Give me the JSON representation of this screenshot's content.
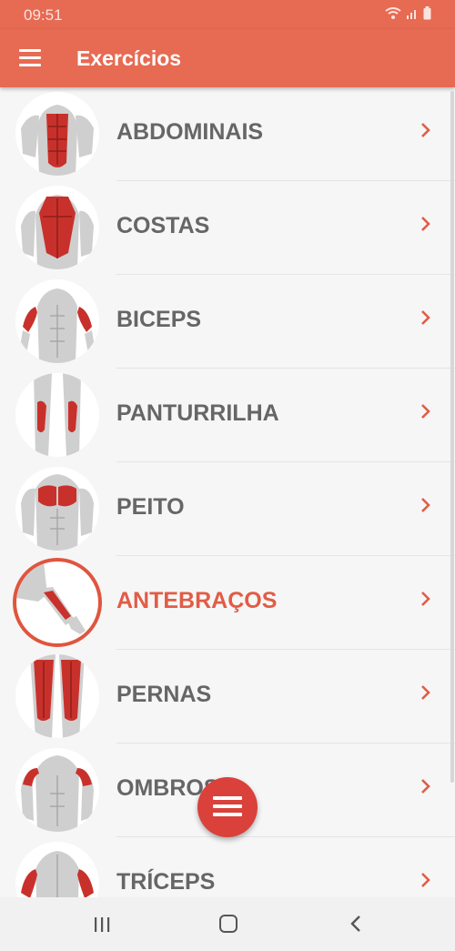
{
  "status_bar": {
    "time": "09:51"
  },
  "app_bar": {
    "title": "Exercícios"
  },
  "exercises": [
    {
      "label": "ABDOMINAIS",
      "selected": false
    },
    {
      "label": "COSTAS",
      "selected": false
    },
    {
      "label": "BICEPS",
      "selected": false
    },
    {
      "label": "PANTURRILHA",
      "selected": false
    },
    {
      "label": "PEITO",
      "selected": false
    },
    {
      "label": "ANTEBRAÇOS",
      "selected": true
    },
    {
      "label": "PERNAS",
      "selected": false
    },
    {
      "label": "OMBROS",
      "selected": false
    },
    {
      "label": "TRÍCEPS",
      "selected": false
    }
  ],
  "colors": {
    "primary": "#e76a52",
    "accent": "#e25c45",
    "fab": "#d9413a",
    "muscle": "#c8312b",
    "body": "#cfcfcf",
    "text": "#666666"
  },
  "icons": {
    "menu": "hamburger-icon",
    "chevron": "chevron-right-icon",
    "fab": "menu-fab-icon"
  }
}
